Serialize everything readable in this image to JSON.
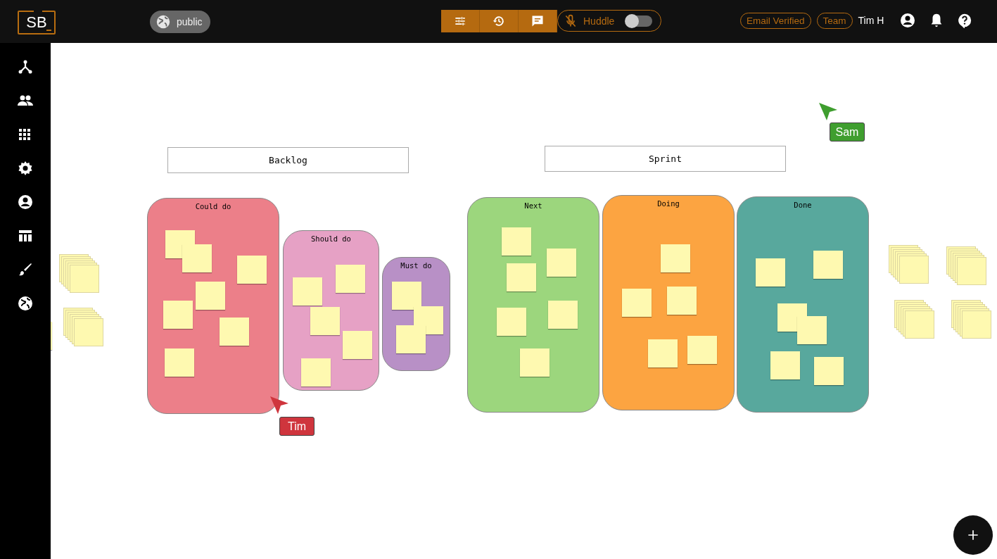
{
  "header": {
    "logo": "SB",
    "visibility": "public",
    "toolbar": [
      {
        "kind": "settings"
      },
      {
        "kind": "history"
      },
      {
        "kind": "chat"
      }
    ],
    "huddle": {
      "label": "Huddle",
      "on": false,
      "muted": true
    },
    "badges": [
      "Email Verified",
      "Team"
    ],
    "user": "Tim H"
  },
  "sidebar": {
    "items": [
      {
        "kind": "hierarchy"
      },
      {
        "kind": "people"
      },
      {
        "kind": "grid"
      },
      {
        "kind": "settings"
      },
      {
        "kind": "account"
      },
      {
        "kind": "table"
      },
      {
        "kind": "brush"
      },
      {
        "kind": "globe"
      }
    ]
  },
  "board": {
    "sections": [
      "Backlog",
      "Sprint"
    ],
    "lanes": [
      {
        "label": "Could do",
        "color": "#ec7f89"
      },
      {
        "label": "Should do",
        "color": "#e6a1c5"
      },
      {
        "label": "Must do",
        "color": "#b890c6"
      },
      {
        "label": "Next",
        "color": "#9cd67d"
      },
      {
        "label": "Doing",
        "color": "#fca441"
      },
      {
        "label": "Done",
        "color": "#58a89d"
      }
    ],
    "cursors": [
      {
        "name": "Sam",
        "color": "#3f9e2f"
      },
      {
        "name": "Tim",
        "color": "#cf353d"
      }
    ]
  }
}
